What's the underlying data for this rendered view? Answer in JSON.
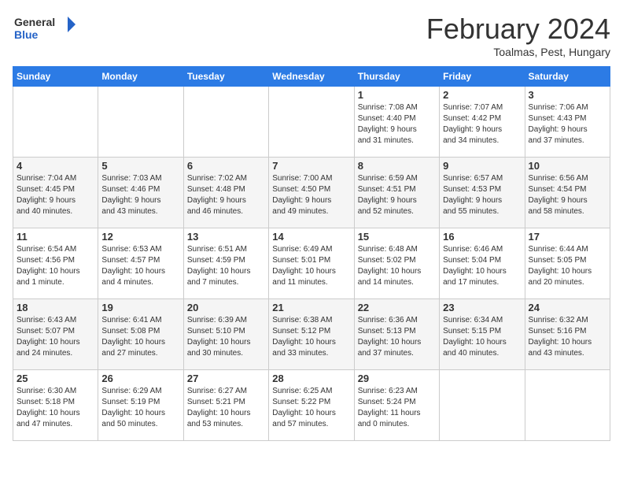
{
  "header": {
    "logo_line1": "General",
    "logo_line2": "Blue",
    "month": "February 2024",
    "location": "Toalmas, Pest, Hungary"
  },
  "weekdays": [
    "Sunday",
    "Monday",
    "Tuesday",
    "Wednesday",
    "Thursday",
    "Friday",
    "Saturday"
  ],
  "weeks": [
    [
      {
        "num": "",
        "info": ""
      },
      {
        "num": "",
        "info": ""
      },
      {
        "num": "",
        "info": ""
      },
      {
        "num": "",
        "info": ""
      },
      {
        "num": "1",
        "info": "Sunrise: 7:08 AM\nSunset: 4:40 PM\nDaylight: 9 hours\nand 31 minutes."
      },
      {
        "num": "2",
        "info": "Sunrise: 7:07 AM\nSunset: 4:42 PM\nDaylight: 9 hours\nand 34 minutes."
      },
      {
        "num": "3",
        "info": "Sunrise: 7:06 AM\nSunset: 4:43 PM\nDaylight: 9 hours\nand 37 minutes."
      }
    ],
    [
      {
        "num": "4",
        "info": "Sunrise: 7:04 AM\nSunset: 4:45 PM\nDaylight: 9 hours\nand 40 minutes."
      },
      {
        "num": "5",
        "info": "Sunrise: 7:03 AM\nSunset: 4:46 PM\nDaylight: 9 hours\nand 43 minutes."
      },
      {
        "num": "6",
        "info": "Sunrise: 7:02 AM\nSunset: 4:48 PM\nDaylight: 9 hours\nand 46 minutes."
      },
      {
        "num": "7",
        "info": "Sunrise: 7:00 AM\nSunset: 4:50 PM\nDaylight: 9 hours\nand 49 minutes."
      },
      {
        "num": "8",
        "info": "Sunrise: 6:59 AM\nSunset: 4:51 PM\nDaylight: 9 hours\nand 52 minutes."
      },
      {
        "num": "9",
        "info": "Sunrise: 6:57 AM\nSunset: 4:53 PM\nDaylight: 9 hours\nand 55 minutes."
      },
      {
        "num": "10",
        "info": "Sunrise: 6:56 AM\nSunset: 4:54 PM\nDaylight: 9 hours\nand 58 minutes."
      }
    ],
    [
      {
        "num": "11",
        "info": "Sunrise: 6:54 AM\nSunset: 4:56 PM\nDaylight: 10 hours\nand 1 minute."
      },
      {
        "num": "12",
        "info": "Sunrise: 6:53 AM\nSunset: 4:57 PM\nDaylight: 10 hours\nand 4 minutes."
      },
      {
        "num": "13",
        "info": "Sunrise: 6:51 AM\nSunset: 4:59 PM\nDaylight: 10 hours\nand 7 minutes."
      },
      {
        "num": "14",
        "info": "Sunrise: 6:49 AM\nSunset: 5:01 PM\nDaylight: 10 hours\nand 11 minutes."
      },
      {
        "num": "15",
        "info": "Sunrise: 6:48 AM\nSunset: 5:02 PM\nDaylight: 10 hours\nand 14 minutes."
      },
      {
        "num": "16",
        "info": "Sunrise: 6:46 AM\nSunset: 5:04 PM\nDaylight: 10 hours\nand 17 minutes."
      },
      {
        "num": "17",
        "info": "Sunrise: 6:44 AM\nSunset: 5:05 PM\nDaylight: 10 hours\nand 20 minutes."
      }
    ],
    [
      {
        "num": "18",
        "info": "Sunrise: 6:43 AM\nSunset: 5:07 PM\nDaylight: 10 hours\nand 24 minutes."
      },
      {
        "num": "19",
        "info": "Sunrise: 6:41 AM\nSunset: 5:08 PM\nDaylight: 10 hours\nand 27 minutes."
      },
      {
        "num": "20",
        "info": "Sunrise: 6:39 AM\nSunset: 5:10 PM\nDaylight: 10 hours\nand 30 minutes."
      },
      {
        "num": "21",
        "info": "Sunrise: 6:38 AM\nSunset: 5:12 PM\nDaylight: 10 hours\nand 33 minutes."
      },
      {
        "num": "22",
        "info": "Sunrise: 6:36 AM\nSunset: 5:13 PM\nDaylight: 10 hours\nand 37 minutes."
      },
      {
        "num": "23",
        "info": "Sunrise: 6:34 AM\nSunset: 5:15 PM\nDaylight: 10 hours\nand 40 minutes."
      },
      {
        "num": "24",
        "info": "Sunrise: 6:32 AM\nSunset: 5:16 PM\nDaylight: 10 hours\nand 43 minutes."
      }
    ],
    [
      {
        "num": "25",
        "info": "Sunrise: 6:30 AM\nSunset: 5:18 PM\nDaylight: 10 hours\nand 47 minutes."
      },
      {
        "num": "26",
        "info": "Sunrise: 6:29 AM\nSunset: 5:19 PM\nDaylight: 10 hours\nand 50 minutes."
      },
      {
        "num": "27",
        "info": "Sunrise: 6:27 AM\nSunset: 5:21 PM\nDaylight: 10 hours\nand 53 minutes."
      },
      {
        "num": "28",
        "info": "Sunrise: 6:25 AM\nSunset: 5:22 PM\nDaylight: 10 hours\nand 57 minutes."
      },
      {
        "num": "29",
        "info": "Sunrise: 6:23 AM\nSunset: 5:24 PM\nDaylight: 11 hours\nand 0 minutes."
      },
      {
        "num": "",
        "info": ""
      },
      {
        "num": "",
        "info": ""
      }
    ]
  ]
}
